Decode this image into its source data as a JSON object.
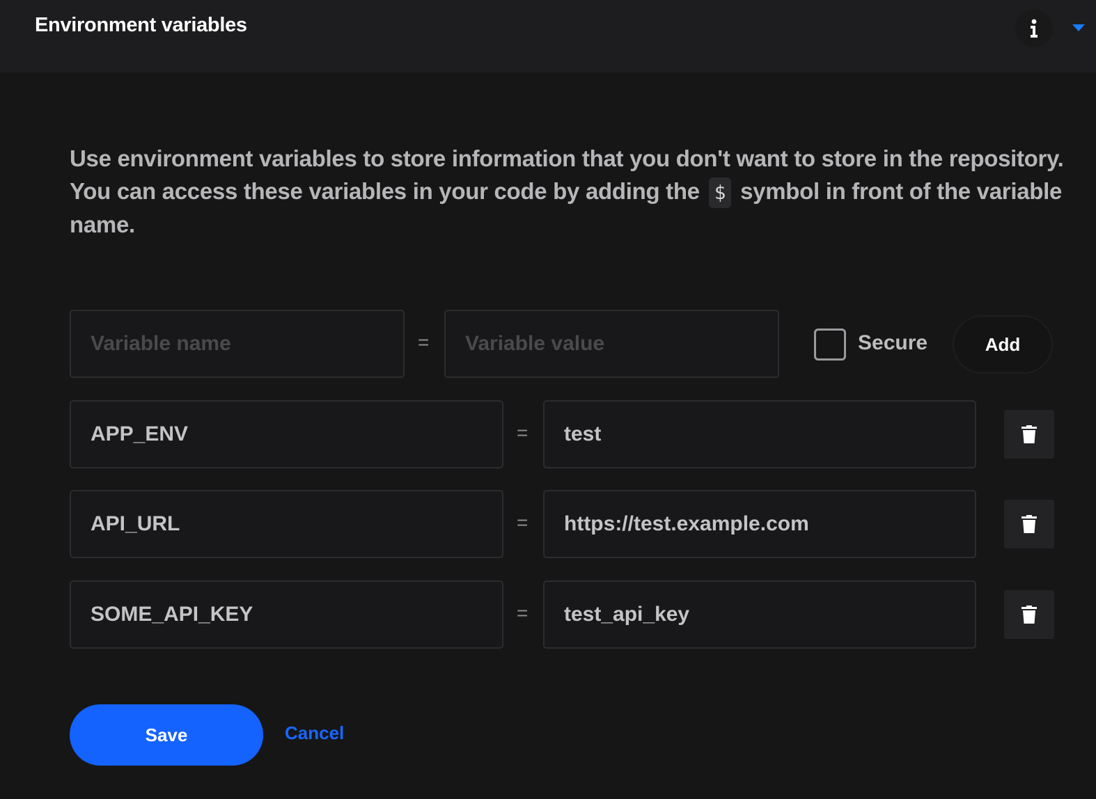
{
  "header": {
    "title": "Environment variables",
    "info_icon": "info-icon",
    "chevron_icon": "chevron-down-icon",
    "accent_color": "#1a7cff"
  },
  "description": {
    "before_code": "Use environment variables to store information that you don't want to store in the repository. You can access these variables in your code by adding the",
    "code": "$",
    "after_code": "symbol in front of the variable name."
  },
  "new_variable": {
    "name_placeholder": "Variable name",
    "value_placeholder": "Variable value",
    "equals": "=",
    "secure_label": "Secure",
    "secure_checked": false,
    "add_label": "Add"
  },
  "variables": [
    {
      "name": "APP_ENV",
      "equals": "=",
      "value": "test",
      "delete_icon": "trash-icon"
    },
    {
      "name": "API_URL",
      "equals": "=",
      "value": "https://test.example.com",
      "delete_icon": "trash-icon"
    },
    {
      "name": "SOME_API_KEY",
      "equals": "=",
      "value": "test_api_key",
      "delete_icon": "trash-icon"
    }
  ],
  "actions": {
    "save_label": "Save",
    "cancel_label": "Cancel",
    "primary_color": "#1463ff"
  }
}
